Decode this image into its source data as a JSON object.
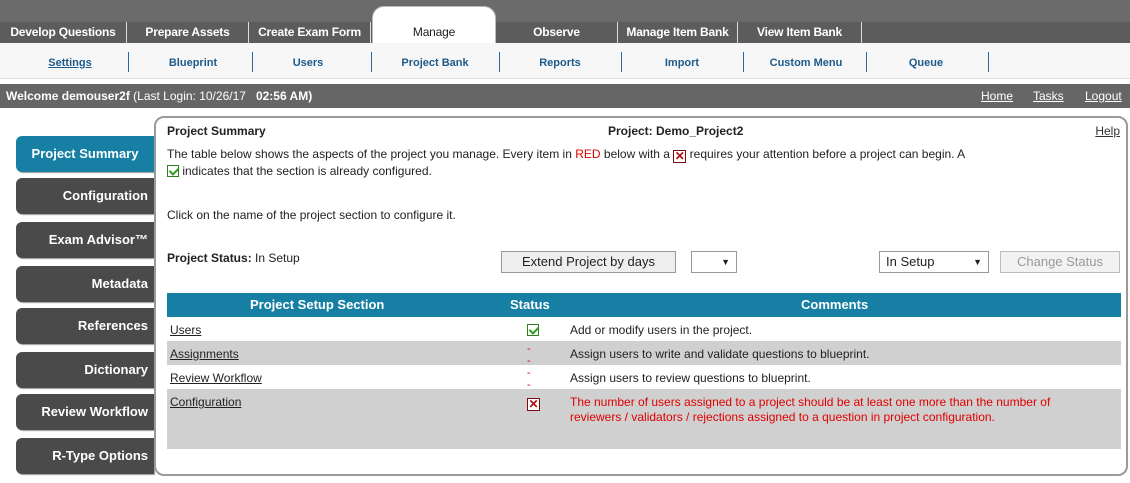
{
  "top_nav": {
    "tabs": [
      {
        "label": "Develop Questions"
      },
      {
        "label": "Prepare Assets"
      },
      {
        "label": "Create Exam Form"
      },
      {
        "label": "Manage",
        "active": true
      },
      {
        "label": "Observe"
      },
      {
        "label": "Manage Item Bank"
      },
      {
        "label": "View Item Bank"
      }
    ]
  },
  "sub_nav": {
    "tabs": [
      {
        "label": "Settings",
        "active": true
      },
      {
        "label": "Blueprint"
      },
      {
        "label": "Users"
      },
      {
        "label": "Project Bank"
      },
      {
        "label": "Reports"
      },
      {
        "label": "Import"
      },
      {
        "label": "Custom Menu"
      },
      {
        "label": "Queue"
      }
    ]
  },
  "welcome_bar": {
    "user": "Welcome demouser2f",
    "last_login": "(Last Login: 10/26/17",
    "time": "02:56 AM)",
    "links": [
      "Home",
      "Tasks",
      "Logout"
    ]
  },
  "sidebar": {
    "items": [
      {
        "label": "Project Summary",
        "active": true
      },
      {
        "label": "Configuration"
      },
      {
        "label": "Exam Advisor™"
      },
      {
        "label": "Metadata"
      },
      {
        "label": "References"
      },
      {
        "label": "Dictionary"
      },
      {
        "label": "Review Workflow"
      },
      {
        "label": "R-Type Options"
      }
    ]
  },
  "panel": {
    "title": "Project Summary",
    "project": "Project: Demo_Project2",
    "help": "Help",
    "intro_a": "The table below shows the aspects of the project you manage. Every item in",
    "intro_red": "RED",
    "intro_b": "below with a",
    "intro_c": "requires your attention before a project can begin. A",
    "intro_d": "indicates that the section is already configured.",
    "click_text": "Click on the name of the project section to configure it.",
    "status_label": "Project Status:",
    "status_value": "In Setup",
    "extend_button": "Extend Project by days",
    "days_select": "",
    "status_select": "In Setup",
    "change_status_button": "Change Status"
  },
  "table": {
    "headers": [
      "Project Setup Section",
      "Status",
      "Comments"
    ],
    "rows": [
      {
        "section": "Users",
        "status": "check",
        "comment": "Add or modify users in the project."
      },
      {
        "section": "Assignments",
        "status": "dash",
        "status_text": "--",
        "comment": "Assign users to write and validate questions to blueprint."
      },
      {
        "section": "Review Workflow",
        "status": "dash",
        "status_text": "--",
        "comment": "Assign users to review questions to blueprint."
      },
      {
        "section": "Configuration",
        "status": "x",
        "comment": "The number of users assigned to a project should be at least one more than the number of reviewers / validators / rejections assigned to a question in project configuration.",
        "comment_color": "#e00000"
      }
    ]
  },
  "colors": {
    "accent": "#167fa3",
    "alert": "#e00000",
    "nav_dark": "#5c5c5c"
  }
}
